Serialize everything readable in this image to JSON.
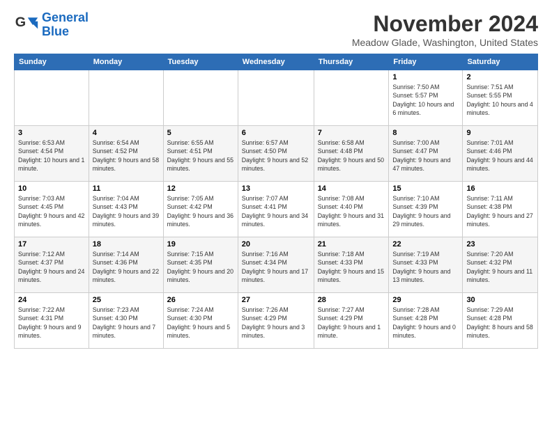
{
  "logo": {
    "line1": "General",
    "line2": "Blue"
  },
  "title": "November 2024",
  "location": "Meadow Glade, Washington, United States",
  "weekdays": [
    "Sunday",
    "Monday",
    "Tuesday",
    "Wednesday",
    "Thursday",
    "Friday",
    "Saturday"
  ],
  "weeks": [
    [
      {
        "day": "",
        "info": ""
      },
      {
        "day": "",
        "info": ""
      },
      {
        "day": "",
        "info": ""
      },
      {
        "day": "",
        "info": ""
      },
      {
        "day": "",
        "info": ""
      },
      {
        "day": "1",
        "info": "Sunrise: 7:50 AM\nSunset: 5:57 PM\nDaylight: 10 hours\nand 6 minutes."
      },
      {
        "day": "2",
        "info": "Sunrise: 7:51 AM\nSunset: 5:55 PM\nDaylight: 10 hours\nand 4 minutes."
      }
    ],
    [
      {
        "day": "3",
        "info": "Sunrise: 6:53 AM\nSunset: 4:54 PM\nDaylight: 10 hours\nand 1 minute."
      },
      {
        "day": "4",
        "info": "Sunrise: 6:54 AM\nSunset: 4:52 PM\nDaylight: 9 hours\nand 58 minutes."
      },
      {
        "day": "5",
        "info": "Sunrise: 6:55 AM\nSunset: 4:51 PM\nDaylight: 9 hours\nand 55 minutes."
      },
      {
        "day": "6",
        "info": "Sunrise: 6:57 AM\nSunset: 4:50 PM\nDaylight: 9 hours\nand 52 minutes."
      },
      {
        "day": "7",
        "info": "Sunrise: 6:58 AM\nSunset: 4:48 PM\nDaylight: 9 hours\nand 50 minutes."
      },
      {
        "day": "8",
        "info": "Sunrise: 7:00 AM\nSunset: 4:47 PM\nDaylight: 9 hours\nand 47 minutes."
      },
      {
        "day": "9",
        "info": "Sunrise: 7:01 AM\nSunset: 4:46 PM\nDaylight: 9 hours\nand 44 minutes."
      }
    ],
    [
      {
        "day": "10",
        "info": "Sunrise: 7:03 AM\nSunset: 4:45 PM\nDaylight: 9 hours\nand 42 minutes."
      },
      {
        "day": "11",
        "info": "Sunrise: 7:04 AM\nSunset: 4:43 PM\nDaylight: 9 hours\nand 39 minutes."
      },
      {
        "day": "12",
        "info": "Sunrise: 7:05 AM\nSunset: 4:42 PM\nDaylight: 9 hours\nand 36 minutes."
      },
      {
        "day": "13",
        "info": "Sunrise: 7:07 AM\nSunset: 4:41 PM\nDaylight: 9 hours\nand 34 minutes."
      },
      {
        "day": "14",
        "info": "Sunrise: 7:08 AM\nSunset: 4:40 PM\nDaylight: 9 hours\nand 31 minutes."
      },
      {
        "day": "15",
        "info": "Sunrise: 7:10 AM\nSunset: 4:39 PM\nDaylight: 9 hours\nand 29 minutes."
      },
      {
        "day": "16",
        "info": "Sunrise: 7:11 AM\nSunset: 4:38 PM\nDaylight: 9 hours\nand 27 minutes."
      }
    ],
    [
      {
        "day": "17",
        "info": "Sunrise: 7:12 AM\nSunset: 4:37 PM\nDaylight: 9 hours\nand 24 minutes."
      },
      {
        "day": "18",
        "info": "Sunrise: 7:14 AM\nSunset: 4:36 PM\nDaylight: 9 hours\nand 22 minutes."
      },
      {
        "day": "19",
        "info": "Sunrise: 7:15 AM\nSunset: 4:35 PM\nDaylight: 9 hours\nand 20 minutes."
      },
      {
        "day": "20",
        "info": "Sunrise: 7:16 AM\nSunset: 4:34 PM\nDaylight: 9 hours\nand 17 minutes."
      },
      {
        "day": "21",
        "info": "Sunrise: 7:18 AM\nSunset: 4:33 PM\nDaylight: 9 hours\nand 15 minutes."
      },
      {
        "day": "22",
        "info": "Sunrise: 7:19 AM\nSunset: 4:33 PM\nDaylight: 9 hours\nand 13 minutes."
      },
      {
        "day": "23",
        "info": "Sunrise: 7:20 AM\nSunset: 4:32 PM\nDaylight: 9 hours\nand 11 minutes."
      }
    ],
    [
      {
        "day": "24",
        "info": "Sunrise: 7:22 AM\nSunset: 4:31 PM\nDaylight: 9 hours\nand 9 minutes."
      },
      {
        "day": "25",
        "info": "Sunrise: 7:23 AM\nSunset: 4:30 PM\nDaylight: 9 hours\nand 7 minutes."
      },
      {
        "day": "26",
        "info": "Sunrise: 7:24 AM\nSunset: 4:30 PM\nDaylight: 9 hours\nand 5 minutes."
      },
      {
        "day": "27",
        "info": "Sunrise: 7:26 AM\nSunset: 4:29 PM\nDaylight: 9 hours\nand 3 minutes."
      },
      {
        "day": "28",
        "info": "Sunrise: 7:27 AM\nSunset: 4:29 PM\nDaylight: 9 hours\nand 1 minute."
      },
      {
        "day": "29",
        "info": "Sunrise: 7:28 AM\nSunset: 4:28 PM\nDaylight: 9 hours\nand 0 minutes."
      },
      {
        "day": "30",
        "info": "Sunrise: 7:29 AM\nSunset: 4:28 PM\nDaylight: 8 hours\nand 58 minutes."
      }
    ]
  ]
}
